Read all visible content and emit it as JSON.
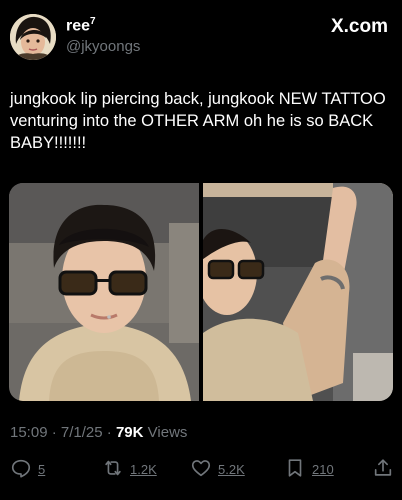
{
  "author": {
    "display_name": "ree",
    "display_sup": "7",
    "handle": "@jkyoongs"
  },
  "brand": "X.com",
  "tweet": {
    "text": "jungkook lip piercing back, jungkook NEW TATTOO venturing into the OTHER ARM oh he is so BACK BABY!!!!!!!"
  },
  "meta": {
    "time": "15:09",
    "sep1": "·",
    "date": "7/1/25",
    "sep2": "·",
    "views_count": "79K",
    "views_label": "Views"
  },
  "actions": {
    "replies": "5",
    "reposts": "1.2K",
    "likes": "5.2K",
    "bookmarks": "210"
  },
  "icons": {
    "reply": "reply-icon",
    "repost": "repost-icon",
    "like": "heart-icon",
    "bookmark": "bookmark-icon",
    "share": "share-icon"
  },
  "colors": {
    "background": "#000000",
    "text": "#ffffff",
    "muted": "#71767b"
  }
}
